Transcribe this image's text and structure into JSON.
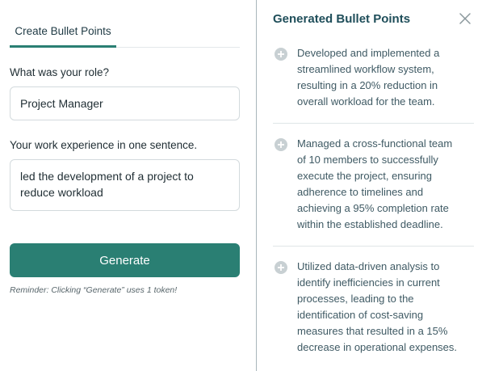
{
  "left": {
    "tab_label": "Create Bullet Points",
    "role": {
      "label": "What was your role?",
      "value": "Project Manager"
    },
    "experience": {
      "label": "Your work experience in one sentence.",
      "value": "led the development of a project to reduce workload"
    },
    "generate_label": "Generate",
    "reminder": "Reminder: Clicking “Generate” uses 1 token!"
  },
  "right": {
    "title": "Generated Bullet Points",
    "bullets": [
      {
        "text": "Developed and implemented a streamlined workflow system, resulting in a 20% reduction in overall workload for the team."
      },
      {
        "text": "Managed a cross-functional team of 10 members to successfully execute the project, ensuring adherence to timelines and achieving a 95% completion rate within the established deadline."
      },
      {
        "text": "Utilized data-driven analysis to identify inefficiencies in current processes, leading to the identification of cost-saving measures that resulted in a 15% decrease in operational expenses."
      }
    ]
  },
  "colors": {
    "accent": "#2a7f73",
    "title": "#1f4e5a",
    "bullet_icon": "#c8d0d3"
  },
  "icons": {
    "close": "close-icon",
    "bullet": "plus-circle-icon"
  }
}
